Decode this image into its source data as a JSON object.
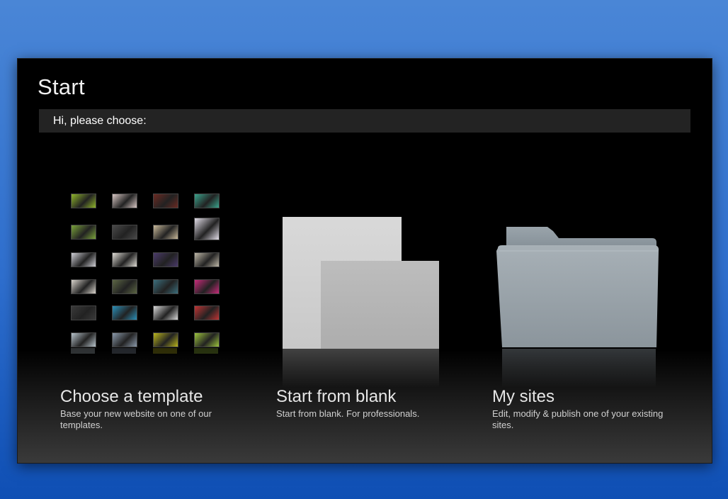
{
  "window": {
    "title": "Start",
    "greeting": "Hi, please choose:"
  },
  "options": [
    {
      "title": "Choose a template",
      "description": "Base your new website on one of our templates."
    },
    {
      "title": "Start from blank",
      "description": "Start from blank. For professionals."
    },
    {
      "title": "My sites",
      "description": "Edit, modify & publish one of your existing sites."
    }
  ],
  "template_thumbnail_colors": [
    [
      "#8fb52a",
      "#d8c7c4",
      "#6b2a22",
      "#3aa38c"
    ],
    [
      "#7aa33a",
      "#4a4a4a",
      "#c9b99a",
      "#e2dde8"
    ],
    [
      "#cfcfd6",
      "#e0ddd6",
      "#4a3a6a",
      "#bfb8a8"
    ],
    [
      "#d9d4cc",
      "#5c6644",
      "#3b6e7c",
      "#c82a7a"
    ],
    [
      "#3a3a3a",
      "#2a8fb8",
      "#d8d8d8",
      "#c03434"
    ],
    [
      "#b8c4cc",
      "#8a99aa",
      "#b9b41c",
      "#9cc43c"
    ]
  ],
  "icons": {
    "blank_pages": "blank-pages-icon",
    "folder": "folder-icon"
  }
}
